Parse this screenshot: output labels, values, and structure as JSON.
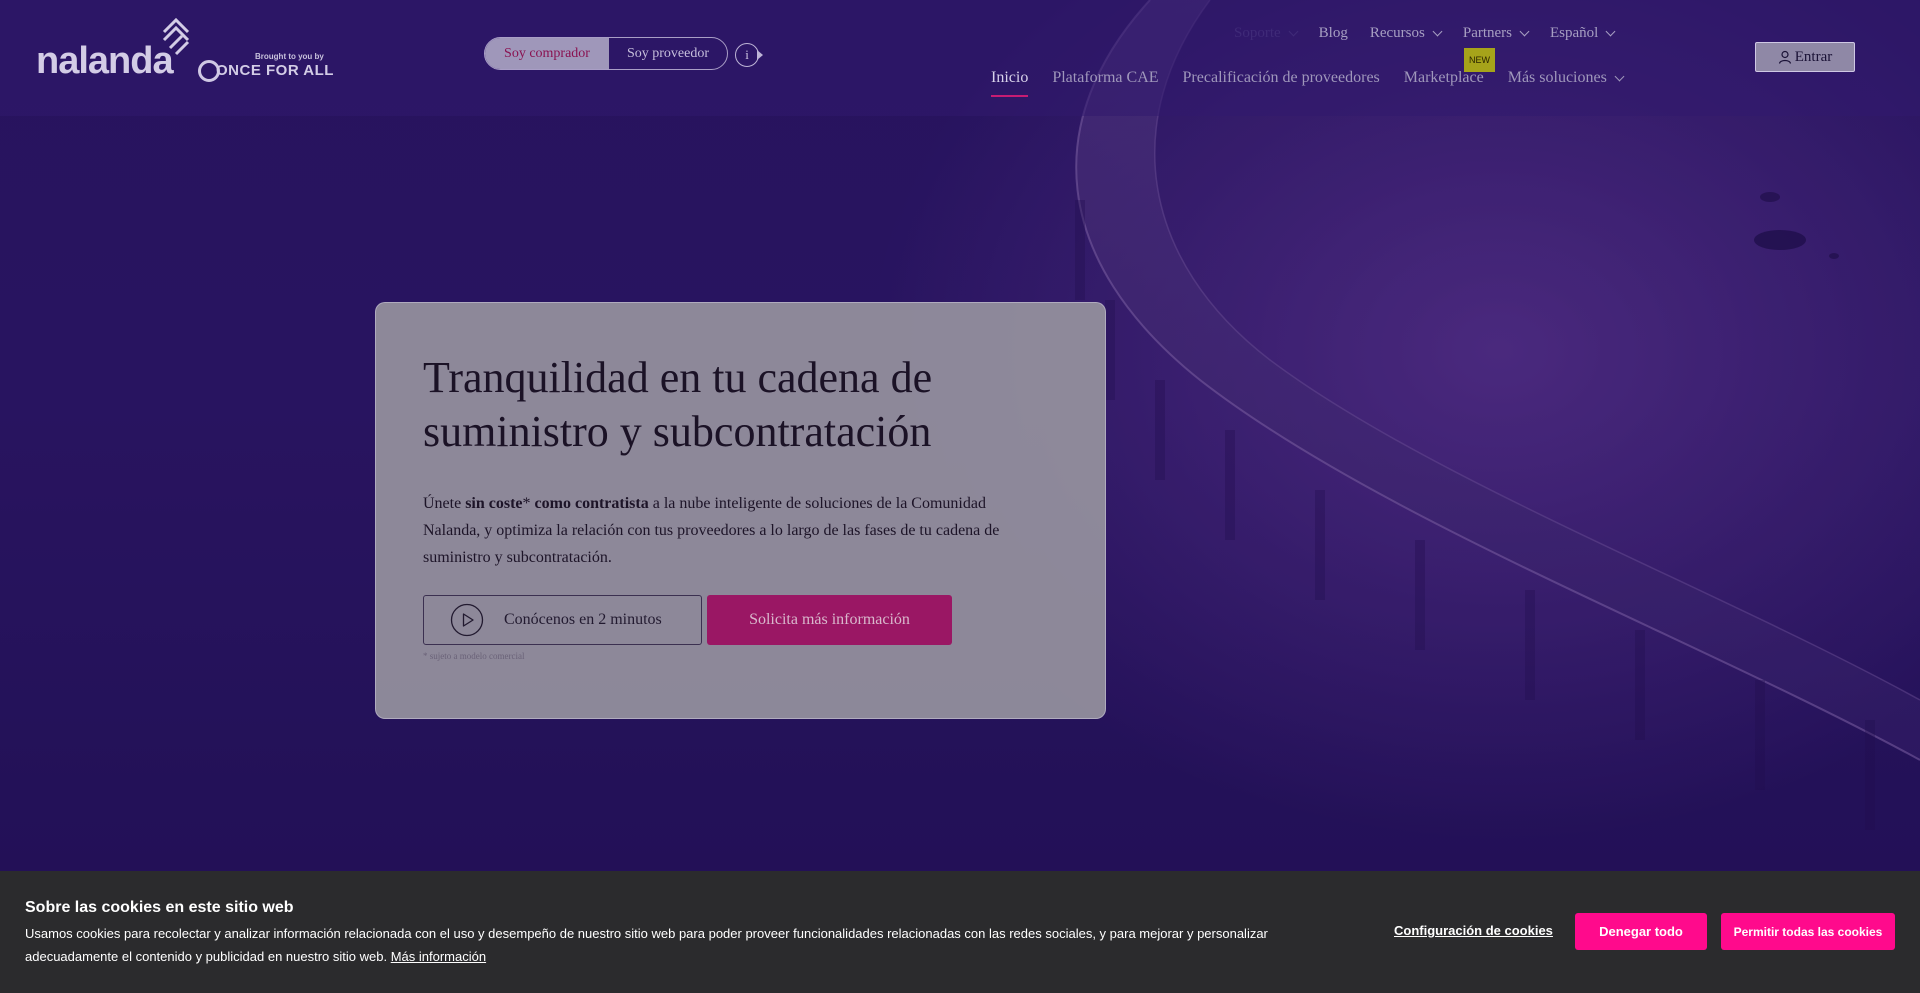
{
  "brand": {
    "logo_text": "nalanda",
    "partner_small": "Brought to you by",
    "partner_name": "ONCE FOR ALL"
  },
  "role_toggle": {
    "buyer": "Soy comprador",
    "supplier": "Soy proveedor",
    "info": "i"
  },
  "top_links": [
    {
      "label": "Soporte",
      "dropdown": true
    },
    {
      "label": "Blog",
      "dropdown": false
    },
    {
      "label": "Recursos",
      "dropdown": true
    },
    {
      "label": "Partners",
      "dropdown": true
    },
    {
      "label": "Español",
      "dropdown": true
    }
  ],
  "main_nav": [
    {
      "label": "Inicio",
      "active": true
    },
    {
      "label": "Plataforma CAE"
    },
    {
      "label": "Precalificación de proveedores"
    },
    {
      "label": "Marketplace",
      "badge": "NEW"
    },
    {
      "label": "Más soluciones",
      "dropdown": true
    }
  ],
  "login": {
    "label": "Entrar",
    "icon": "user-icon"
  },
  "hero": {
    "title": "Tranquilidad en tu cadena de suministro y subcontratación",
    "text_before": "Únete ",
    "text_bold_1": "sin coste",
    "text_mid": "* ",
    "text_bold_2": "como contratista",
    "text_after": " a la nube inteligente de soluciones de la Comunidad Nalanda, y optimiza la relación con tus proveedores a lo largo de las fases de tu cadena de suministro y subcontratación.",
    "video_button": "Conócenos en 2 minutos",
    "cta_button": "Solicita más información",
    "footnote": "* sujeto a modelo comercial"
  },
  "cookie": {
    "title": "Sobre las cookies en este sitio web",
    "text": "Usamos cookies para recolectar y analizar información relacionada con el uso y desempeño de nuestro sitio web para poder proveer funcionalidades relacionadas con las redes sociales, y para mejorar y personalizar adecuadamente el contenido y publicidad en nuestro sitio web.",
    "more_link": "Más información",
    "config_button": "Configuración de cookies",
    "deny_button": "Denegar todo",
    "allow_button": "Permitir todas las cookies"
  },
  "colors": {
    "accent": "#ff0a8c",
    "hero_bg": "#2b1766",
    "badge": "#a6a31a"
  }
}
